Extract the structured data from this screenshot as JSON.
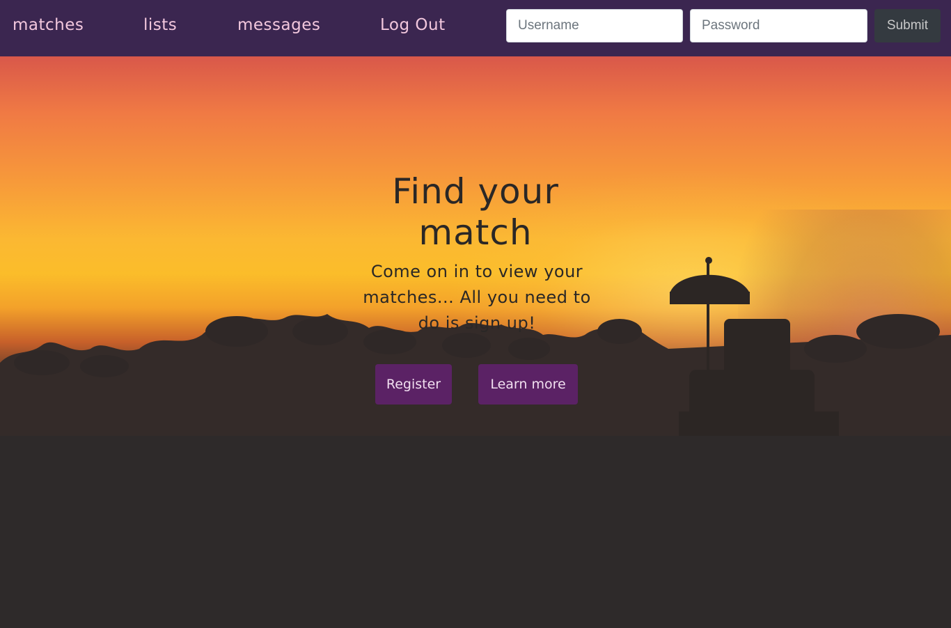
{
  "nav": {
    "links": [
      "matches",
      "lists",
      "messages",
      "Log Out"
    ]
  },
  "login": {
    "username_placeholder": "Username",
    "password_placeholder": "Password",
    "submit_label": "Submit"
  },
  "hero": {
    "title": "Find your match",
    "text": "Come on in to view your matches... All you need to do is sign up!",
    "register_label": "Register",
    "learn_more_label": "Learn more"
  },
  "colors": {
    "navbar": "#3b2650",
    "nav_link": "#f2c7dd",
    "button": "#5b2265"
  }
}
